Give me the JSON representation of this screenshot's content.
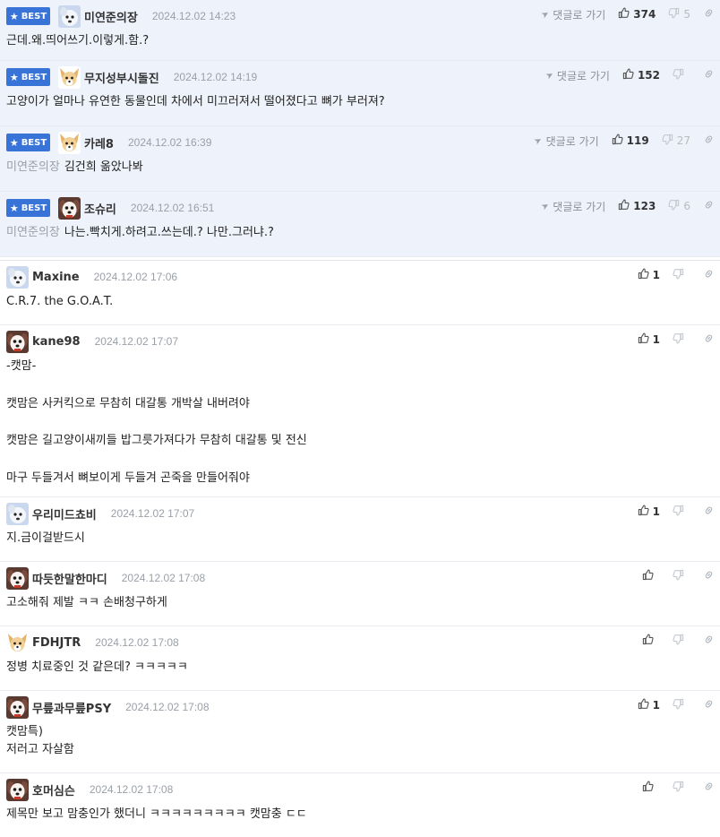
{
  "labels": {
    "best": "BEST",
    "reply": "댓글로 가기"
  },
  "comments": [
    {
      "best": true,
      "nick": "미연준의장",
      "date": "2024.12.02 14:23",
      "likes": "374",
      "dislikes": "5",
      "mention": "",
      "lines": [
        "근데.왜.띄어쓰기.이렇게.함.?"
      ],
      "avatar": "dog-white"
    },
    {
      "best": true,
      "nick": "무지성부시돌진",
      "date": "2024.12.02 14:19",
      "likes": "152",
      "dislikes": "",
      "mention": "",
      "lines": [
        "고양이가 얼마나 유연한 동물인데 차에서 미끄러져서 떨어졌다고 뼈가 부러져?"
      ],
      "avatar": "fox"
    },
    {
      "best": true,
      "nick": "카레8",
      "date": "2024.12.02 16:39",
      "likes": "119",
      "dislikes": "27",
      "mention": "미연준의장",
      "lines": [
        "김건희 옮았나봐"
      ],
      "avatar": "fox"
    },
    {
      "best": true,
      "nick": "조슈리",
      "date": "2024.12.02 16:51",
      "likes": "123",
      "dislikes": "6",
      "mention": "미연준의장",
      "lines": [
        "나는.빡치게.하려고.쓰는데.? 나만.그러냐.?"
      ],
      "avatar": "pup"
    },
    {
      "best": false,
      "nick": "Maxine",
      "date": "2024.12.02 17:06",
      "likes": "1",
      "dislikes": "",
      "mention": "",
      "lines": [
        "C.R.7. the G.O.A.T."
      ],
      "avatar": "dog-white"
    },
    {
      "best": false,
      "nick": "kane98",
      "date": "2024.12.02 17:07",
      "likes": "1",
      "dislikes": "",
      "mention": "",
      "lines": [
        "-캣맘-",
        "",
        "캣맘은 사커킥으로 무참히 대갈통 개박살 내버려야",
        "",
        "캣맘은 길고양이새끼들 밥그릇가져다가 무참히 대갈통 및 전신",
        "",
        "마구 두들겨서 뼈보이게 두들겨 곤죽을 만들어줘야"
      ],
      "avatar": "pup"
    },
    {
      "best": false,
      "nick": "우리미드쵸비",
      "date": "2024.12.02 17:07",
      "likes": "1",
      "dislikes": "",
      "mention": "",
      "lines": [
        "지.금이걸받드시"
      ],
      "avatar": "dog-white"
    },
    {
      "best": false,
      "nick": "따듯한말한마디",
      "date": "2024.12.02 17:08",
      "likes": "",
      "dislikes": "",
      "mention": "",
      "lines": [
        "고소해줘 제발 ㅋㅋ 손배청구하게"
      ],
      "avatar": "pup"
    },
    {
      "best": false,
      "nick": "FDHJTR",
      "date": "2024.12.02 17:08",
      "likes": "",
      "dislikes": "",
      "mention": "",
      "lines": [
        "정병 치료중인 것 같은데? ㅋㅋㅋㅋㅋ"
      ],
      "avatar": "fox"
    },
    {
      "best": false,
      "nick": "무릎과무릎PSY",
      "date": "2024.12.02 17:08",
      "likes": "1",
      "dislikes": "",
      "mention": "",
      "lines": [
        "캣맘특)",
        "저러고 자살함"
      ],
      "avatar": "pup"
    },
    {
      "best": false,
      "nick": "호머심슨",
      "date": "2024.12.02 17:08",
      "likes": "",
      "dislikes": "",
      "mention": "",
      "lines": [
        "제목만 보고 맘충인가 했더니 ㅋㅋㅋㅋㅋㅋㅋㅋㅋ 캣맘충 ㄷㄷ"
      ],
      "avatar": "pup"
    }
  ]
}
